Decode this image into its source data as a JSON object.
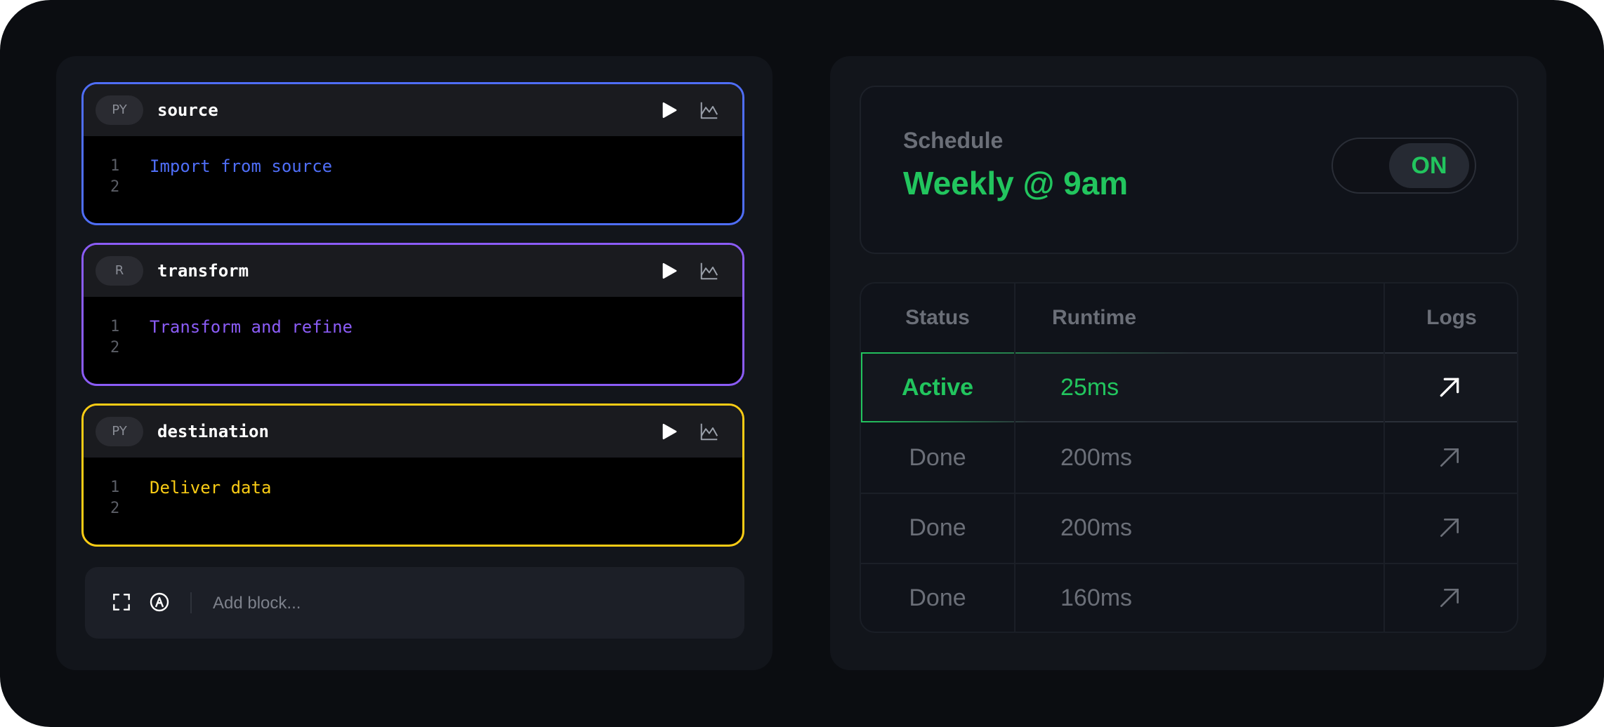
{
  "colors": {
    "accent_green": "#22c55e",
    "source_color": "#4f6ef7",
    "transform_color": "#8b5cf6",
    "destination_color": "#facc15"
  },
  "blocks": [
    {
      "lang": "PY",
      "name": "source",
      "lines": [
        "Import from source",
        ""
      ],
      "line_numbers": [
        "1",
        "2"
      ],
      "color": "#4f6ef7",
      "run_icon": "play-icon",
      "chart_icon": "chart-icon"
    },
    {
      "lang": "R",
      "name": "transform",
      "lines": [
        "Transform and refine",
        ""
      ],
      "line_numbers": [
        "1",
        "2"
      ],
      "color": "#8b5cf6",
      "run_icon": "play-icon",
      "chart_icon": "chart-icon"
    },
    {
      "lang": "PY",
      "name": "destination",
      "lines": [
        "Deliver data",
        ""
      ],
      "line_numbers": [
        "1",
        "2"
      ],
      "color": "#facc15",
      "run_icon": "play-icon",
      "chart_icon": "chart-icon"
    }
  ],
  "add_bar": {
    "placeholder": "Add block...",
    "icons": [
      "expand-icon",
      "ai-icon"
    ]
  },
  "schedule": {
    "label": "Schedule",
    "value": "Weekly @ 9am",
    "toggle_label": "ON"
  },
  "runs": {
    "headers": {
      "status": "Status",
      "runtime": "Runtime",
      "logs": "Logs"
    },
    "rows": [
      {
        "status": "Active",
        "runtime": "25ms",
        "active": true
      },
      {
        "status": "Done",
        "runtime": "200ms",
        "active": false
      },
      {
        "status": "Done",
        "runtime": "200ms",
        "active": false
      },
      {
        "status": "Done",
        "runtime": "160ms",
        "active": false
      }
    ],
    "log_icon": "arrow-up-right-icon"
  }
}
